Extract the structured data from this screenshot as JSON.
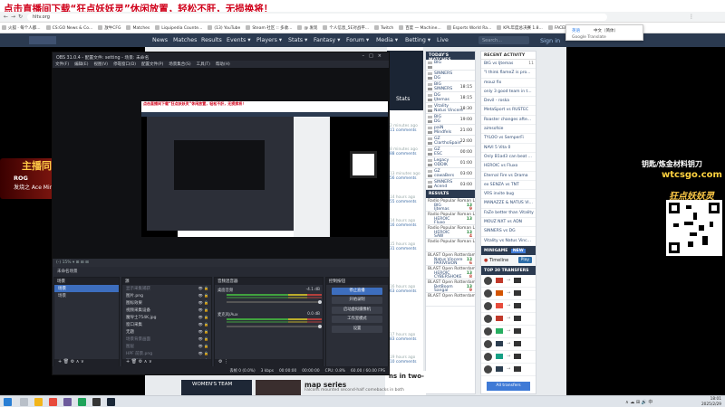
{
  "banner": {
    "text": "点击直播间下载“狂点妖妖灵”休闲放置，轻松不肝，无损换将！"
  },
  "browser": {
    "url": "hltv.org",
    "bookmarks": [
      "火狐 · 每个人都...",
      "CS:GO News & Co...",
      "放牛CFG",
      "Matches",
      "Liquipedia Counte...",
      "(13) YouTube",
      "Steam 社区 :: 多收...",
      "@ 发现",
      "个人信息_5E对战平...",
      "Twitch",
      "百度 一 Machine...",
      "Esports World Ra...",
      "KPL年度总决赛 1.8...",
      "FACEIT.com",
      "SRS7和各种..."
    ],
    "translate": {
      "tab1": "英语",
      "tab2": "中文（简体）",
      "label": "Google Translate"
    }
  },
  "hltv": {
    "nav": [
      "News",
      "Matches",
      "Results",
      "Events",
      "Players",
      "Stats",
      "Fantasy",
      "Forum",
      "Media",
      "Betting",
      "Live"
    ],
    "search_placeholder": "Search...",
    "signin": "Sign in",
    "todays_matches_title": "TODAY'S MATCHES",
    "matches": [
      {
        "t1": "BIG",
        "t2": "",
        "time": ""
      },
      {
        "t1": "SINNERS",
        "t2": "DG",
        "time": ""
      },
      {
        "t1": "BIG",
        "t2": "SINNERS",
        "time": "18:15"
      },
      {
        "t1": "DG",
        "t2": "Ijtemas",
        "time": "18:15"
      },
      {
        "t1": "Vitality",
        "t2": "Natus Vincere",
        "time": "18:30"
      },
      {
        "t1": "BIG",
        "t2": "DG",
        "time": "19:00"
      },
      {
        "t1": "paiN",
        "t2": "Mindfels",
        "time": "21:00"
      },
      {
        "t1": "GZ",
        "t2": "ClarthoSpain",
        "time": "22:00"
      },
      {
        "t1": "GZ",
        "t2": "ESC",
        "time": "00:00"
      },
      {
        "t1": "Legacy",
        "t2": "ODDIK",
        "time": "01:00"
      },
      {
        "t1": "GZ",
        "t2": "cowaBers",
        "time": "03:00"
      },
      {
        "t1": "SINNERS",
        "t2": "Acend",
        "time": "03:00"
      }
    ],
    "results_title": "RESULTS",
    "results": [
      {
        "event": "Radio Popular Roman L...",
        "t1": "BIG",
        "s1": "13",
        "t2": "Ijtemas",
        "s2": "9"
      },
      {
        "event": "Radio Popular Roman L...",
        "t1": "HEROIC",
        "s1": "13",
        "t2": "Fluxo",
        "s2": ""
      },
      {
        "event": "Radio Popular Roman L...",
        "t1": "HEROIC",
        "s1": "13",
        "t2": "SAW",
        "s2": "4"
      },
      {
        "event": "Radio Popular Roman L...",
        "t1": "",
        "s1": "",
        "t2": "",
        "s2": ""
      },
      {
        "event": "BLAST Open Rotterdam...",
        "t1": "Natus Vincere",
        "s1": "13",
        "t2": "PARIVISION",
        "s2": "6"
      },
      {
        "event": "BLAST Open Rotterdam...",
        "t1": "HEROIC",
        "s1": "13",
        "t2": "CYBERSHOKE",
        "s2": "8"
      },
      {
        "event": "BLAST Open Rotterdam...",
        "t1": "BetBoom",
        "s1": "13",
        "t2": "Sangal",
        "s2": "9"
      },
      {
        "event": "BLAST Open Rotterdam...",
        "t1": "",
        "s1": "",
        "t2": "",
        "s2": ""
      }
    ],
    "recent_activity_title": "RECENT ACTIVITY",
    "recent_activity": [
      {
        "text": "BIG vs Ijtemas",
        "n": "11"
      },
      {
        "text": "\"I think flameZ is pro...",
        "n": ""
      },
      {
        "text": "mouz fix",
        "n": ""
      },
      {
        "text": "only 3 good team in t...",
        "n": ""
      },
      {
        "text": "Devil - roska",
        "n": ""
      },
      {
        "text": "MetaSport vs RUSTEC",
        "n": ""
      },
      {
        "text": "Roaster changes afte...",
        "n": ""
      },
      {
        "text": "aimsofsie",
        "n": ""
      },
      {
        "text": "TYLOO vs SemperFi",
        "n": ""
      },
      {
        "text": "NAVI 5 Vita 0",
        "n": ""
      },
      {
        "text": "Only B1ad3 can beat ...",
        "n": ""
      },
      {
        "text": "HEROIC vs Fluxo",
        "n": ""
      },
      {
        "text": "Eternal Fire vs Drama",
        "n": ""
      },
      {
        "text": "ex SENZA vs TNT",
        "n": ""
      },
      {
        "text": "VRS invite bug",
        "n": ""
      },
      {
        "text": "MANAZZE & NATUS VI...",
        "n": ""
      },
      {
        "text": "FaZe better than Vitality",
        "n": ""
      },
      {
        "text": "MOUZ NXT vs ADN",
        "n": ""
      },
      {
        "text": "SINNERS vs DG",
        "n": ""
      },
      {
        "text": "Vitality vs Natus Vinc...",
        "n": ""
      }
    ],
    "minigame_title": "MINIGAME",
    "minigame_badge": "NEW",
    "timeline_label": "Timeline",
    "play_label": "Play",
    "transfers_title": "TOP 30 TRANSFERS",
    "transfers_count": 8,
    "all_transfers": "All transfers",
    "news": [
      {
        "time": "2 minutes ago",
        "comments": "11 comments"
      },
      {
        "time": "8 minutes ago",
        "comments": "88 comments"
      },
      {
        "time": "13 minutes ago",
        "comments": "56 comments"
      },
      {
        "time": "14 hours ago",
        "comments": "55 comments"
      },
      {
        "time": "14 hours ago",
        "comments": "16 comments"
      },
      {
        "time": "15 hours ago",
        "comments": "31 comments"
      },
      {
        "time": "16 hours ago",
        "comments": "63 comments"
      },
      {
        "time": "17 hours ago",
        "comments": "83 comments"
      },
      {
        "time": "19 hours ago",
        "comments": "10 comments"
      }
    ],
    "top_article": "Stats",
    "bottom_headline": "ns in two-",
    "bottom_headline2": "map series",
    "bottom_sub": "Falcons mounted second-half comebacks in both",
    "thumb_text": "WOMEN'S TEAM"
  },
  "overlay": {
    "gift_title": "主播同款",
    "gift_product": "ROG",
    "gift_desc": "发烧之 Ace Mini 专...",
    "right_text1": "钥匙/炼金材料钥刀",
    "right_text2": "wtcsgo.com",
    "right_title": "狂点妖妖灵"
  },
  "obs": {
    "title": "OBS 31.0.4 - 配置文件: setting - 场景: 未命名",
    "menu": [
      "文件(F)",
      "编辑(E)",
      "视图(V)",
      "停靠窗口(D)",
      "配置文件(P)",
      "场景集合(S)",
      "工具(T)",
      "帮助(H)"
    ],
    "toolbar_text": "(-) 15% ▾   ⊞  ⊞  ⊞",
    "scene_label": "未命名场景",
    "panels": {
      "scenes": "场景",
      "sources": "源",
      "mixer": "音频混音器",
      "controls": "控制按钮"
    },
    "scenes": [
      "场景",
      "场景"
    ],
    "sources": [
      {
        "name": "显示采集捕获",
        "dim": true
      },
      {
        "name": "图片.png",
        "dim": false
      },
      {
        "name": "图标效果",
        "dim": false
      },
      {
        "name": "视频采集设备",
        "dim": false
      },
      {
        "name": "魔导士754K.jpg",
        "dim": false
      },
      {
        "name": "窗口采集",
        "dim": false
      },
      {
        "name": "无题",
        "dim": false
      },
      {
        "name": "场景背景画面",
        "dim": true
      },
      {
        "name": "图层",
        "dim": true
      },
      {
        "name": "HPF 前景.png",
        "dim": true
      },
      {
        "name": "图片图画",
        "dim": true
      },
      {
        "name": "图片 1",
        "dim": true
      },
      {
        "name": "图片",
        "dim": false
      },
      {
        "name": "显示器采集",
        "dim": false
      }
    ],
    "mixer": [
      {
        "name": "桌面音频",
        "db": "-4.1 dB"
      },
      {
        "name": "麦克风/Aux",
        "db": "0.0 dB"
      }
    ],
    "controls": [
      "停止直播",
      "开始录制",
      "启动虚拟摄像机",
      "工作室模式",
      "设置"
    ],
    "status": [
      "丢帧 0 (0.0%)",
      "3 kbps",
      "00:00:00",
      "00:00:00",
      "CPU: 0.8%",
      "60.00 / 60.00 FPS"
    ]
  },
  "taskbar": {
    "time": "18:01",
    "date": "2025/2/29"
  }
}
